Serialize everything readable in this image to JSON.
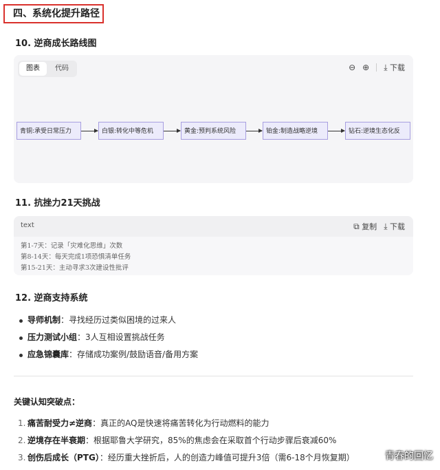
{
  "section_title": "四、系统化提升路径",
  "s10": {
    "heading": "10. 逆商成长路线图",
    "tabs": [
      "图表",
      "代码"
    ],
    "download": "下载",
    "nodes": [
      "青铜:承受日常压力",
      "白银:转化中等危机",
      "黄金:预判系统风险",
      "铂金:制造战略逆境",
      "钻石:逆境生态化反"
    ]
  },
  "s11": {
    "heading": "11. 抗挫力21天挑战",
    "lang": "text",
    "copy": "复制",
    "download": "下载",
    "lines": [
      "第1-7天：记录「灾难化思维」次数",
      "第8-14天：每天完成1项恐惧清单任务",
      "第15-21天：主动寻求3次建设性批评"
    ]
  },
  "s12": {
    "heading": "12. 逆商支持系统",
    "items": [
      {
        "bold": "导师机制",
        "text": "：寻找经历过类似困境的过来人"
      },
      {
        "bold": "压力测试小组",
        "text": "：3人互相设置挑战任务"
      },
      {
        "bold": "应急锦囊库",
        "text": "：存储成功案例/鼓励语音/备用方案"
      }
    ]
  },
  "insight": {
    "heading": "关键认知突破点：",
    "items": [
      {
        "num": "1.",
        "bold": "痛苦耐受力≠逆商",
        "text": "：真正的AQ是快速将痛苦转化为行动燃料的能力"
      },
      {
        "num": "2.",
        "bold": "逆境存在半衰期",
        "text": "：根据耶鲁大学研究，85%的焦虑会在采取首个行动步骤后衰减60%"
      },
      {
        "num": "3.",
        "bold": "创伤后成长（PTG）",
        "text": "：经历重大挫折后，人的创造力峰值可提升3倍（需6-18个月恢复期）"
      }
    ]
  },
  "watermark": "青春的回忆"
}
